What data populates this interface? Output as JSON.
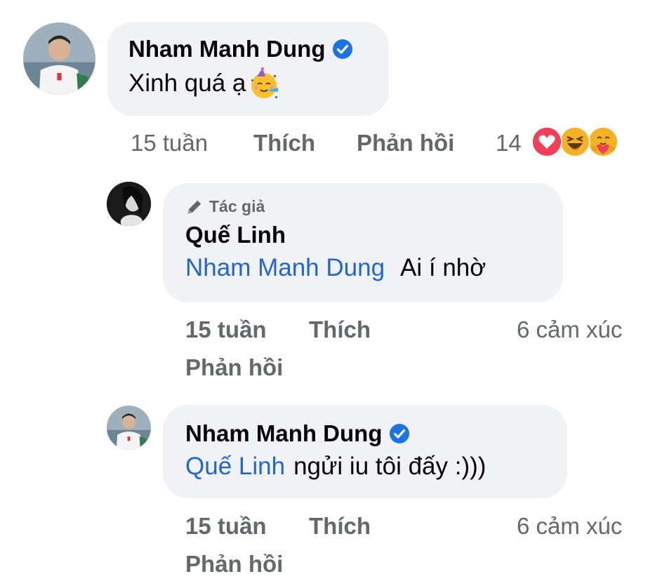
{
  "comment_main": {
    "author": "Nham Manh Dung",
    "verified": true,
    "text": "Xinh quá ạ",
    "emoji_icon": "party-face-icon",
    "time": "15 tuần",
    "like_label": "Thích",
    "reply_label": "Phản hồi",
    "reaction_count": "14",
    "reactions": [
      "love-icon",
      "haha-icon",
      "care-icon"
    ]
  },
  "reply_1": {
    "badge": "Tác giả",
    "author": "Quế Linh",
    "mention": "Nham Manh Dung",
    "text": "Ai í nhờ",
    "time": "15 tuần",
    "like_label": "Thích",
    "reply_label": "Phản hồi",
    "reactions_label": "6 cảm xúc"
  },
  "reply_2": {
    "author": "Nham Manh Dung",
    "verified": true,
    "mention": "Quế Linh",
    "text": "ngửi iu tôi đấy :)))",
    "time": "15 tuần",
    "like_label": "Thích",
    "reply_label": "Phản hồi",
    "reactions_label": "6 cảm xúc"
  },
  "colors": {
    "bubble_bg": "#f0f2f5",
    "meta_text": "#65676b",
    "mention": "#2166d0",
    "verified": "#1b74e4"
  }
}
